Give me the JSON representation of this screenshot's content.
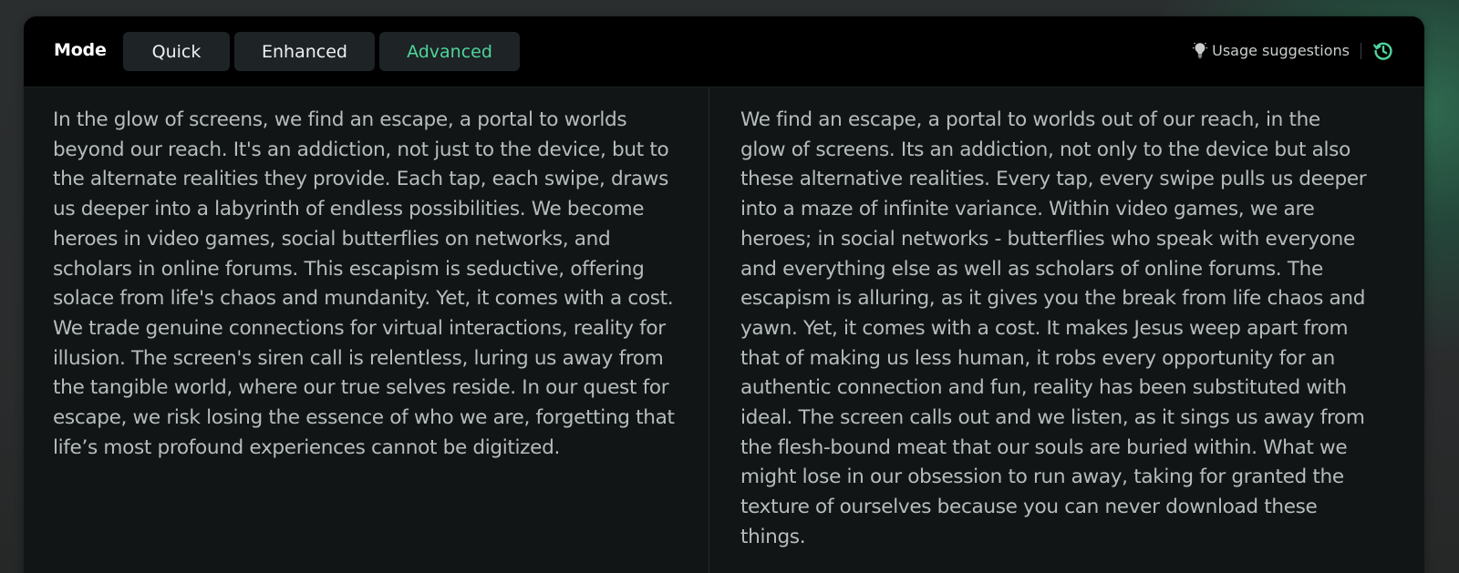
{
  "header": {
    "mode_label": "Mode",
    "tabs": [
      {
        "label": "Quick",
        "active": false
      },
      {
        "label": "Enhanced",
        "active": false
      },
      {
        "label": "Advanced",
        "active": true
      }
    ],
    "suggestions_label": "Usage suggestions",
    "icons": {
      "suggestions": "lightbulb-icon",
      "history": "history-icon"
    }
  },
  "colors": {
    "accent": "#4fd49a",
    "panel_bg": "#111516",
    "header_bg": "#000000",
    "text": "#b6bdbc"
  },
  "input_text": "In the glow of screens, we find an escape, a portal to worlds beyond our reach. It's an addiction, not just to the device, but to the alternate realities they provide. Each tap, each swipe, draws us deeper into a labyrinth of endless possibilities. We become heroes in video games, social butterflies on networks, and scholars in online forums. This escapism is seductive, offering solace from life's chaos and mundanity. Yet, it comes with a cost. We trade genuine connections for virtual interactions, reality for illusion. The screen's siren call is relentless, luring us away from the tangible world, where our true selves reside. In our quest for escape, we risk losing the essence of who we are, forgetting that life’s most profound experiences cannot be digitized.",
  "output_text": "We find an escape, a portal to worlds out of our reach, in the glow of screens. Its an addiction, not only to the device but also these alternative realities. Every tap, every swipe pulls us deeper into a maze of infinite variance. Within video games, we are heroes; in social networks - butterflies who speak with everyone and everything else as well as scholars of online forums. The escapism is alluring, as it gives you the break from life chaos and yawn. Yet, it comes with a cost. It makes Jesus weep apart from that of making us less human, it robs every opportunity for an authentic connection and fun, reality has been substituted with ideal. The screen calls out and we listen, as it sings us away from the flesh-bound meat that our souls are buried within. What we might lose in our obsession to run away, taking for granted the texture of ourselves because you can never download these things."
}
